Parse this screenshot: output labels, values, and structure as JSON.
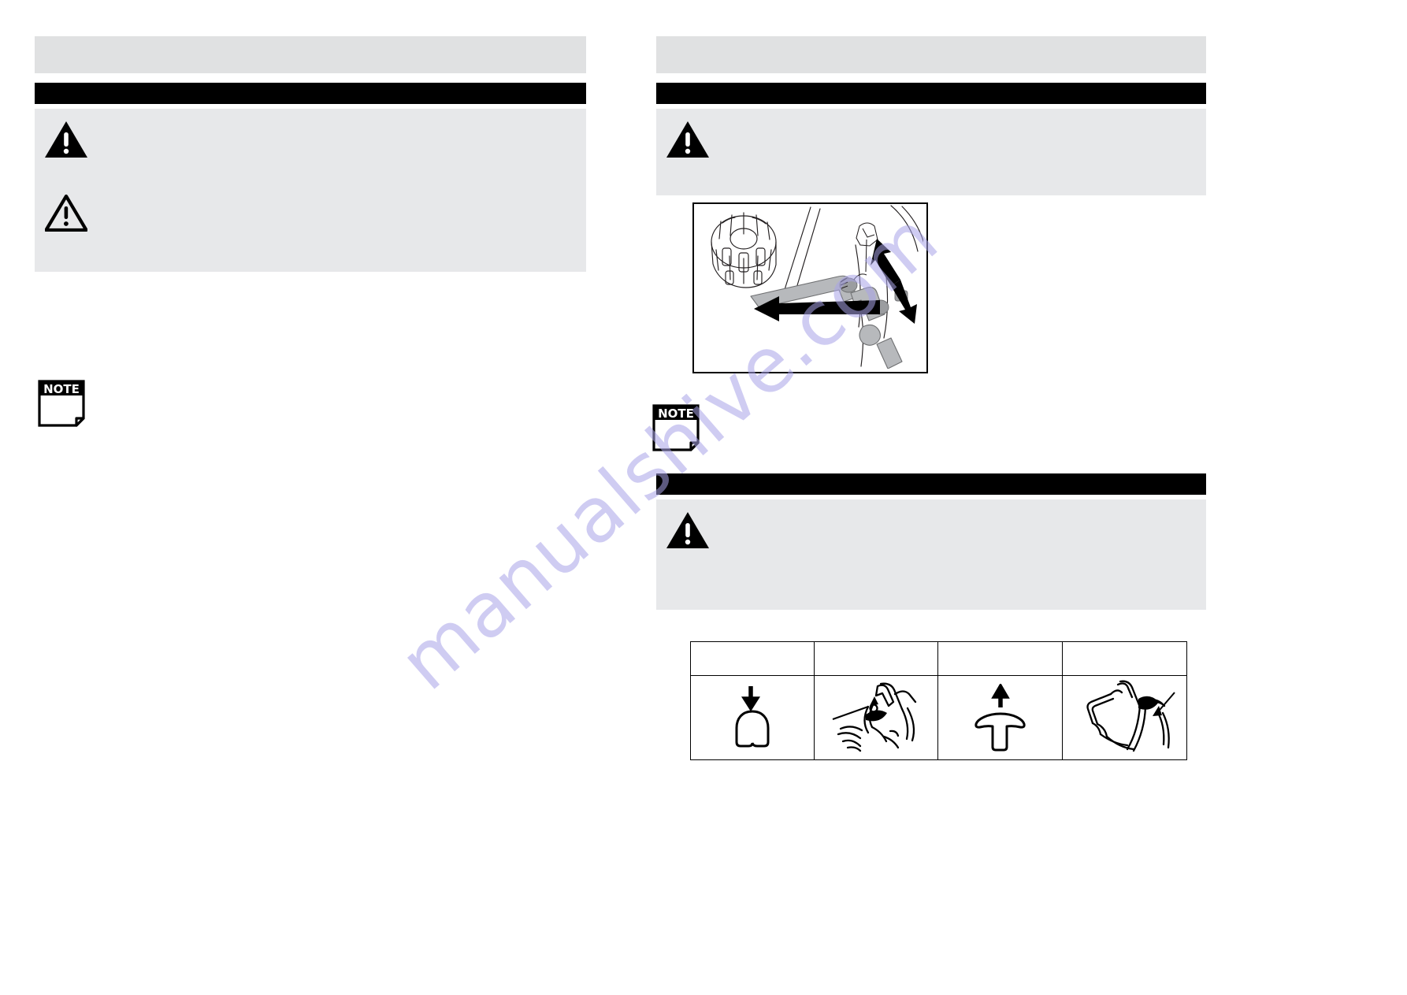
{
  "document": {
    "type": "scanned-manual-page",
    "watermark_text": "manualshive.com",
    "colors": {
      "gray_band": "#e0e1e2",
      "gray_box": "#e7e8ea",
      "black_bar": "#000000",
      "rule": "#000000",
      "watermark": "#a9a4e8"
    }
  },
  "left_column": {
    "heading_band": {
      "label": ""
    },
    "section_bar": {
      "label": ""
    },
    "warning_box": {
      "label": "",
      "icons": [
        {
          "name": "warning-triangle-solid",
          "glyph": "filled-triangle-exclamation"
        },
        {
          "name": "warning-triangle-outline",
          "glyph": "outline-triangle-exclamation"
        }
      ]
    },
    "note": {
      "icon_label": "NOTE",
      "text": ""
    }
  },
  "right_column": {
    "heading_band": {
      "label": ""
    },
    "section_bar_top": {
      "label": ""
    },
    "warning_box_top": {
      "label": "",
      "icons": [
        {
          "name": "warning-triangle-solid",
          "glyph": "filled-triangle-exclamation"
        }
      ]
    },
    "illustration": {
      "caption": "",
      "name": "knob-and-lever-adjustment-diagram",
      "parts": [
        "ribbed-knob",
        "bent-lever-arm",
        "bracket",
        "frame-tube"
      ],
      "arrows": [
        "double-headed-arrow-up-right",
        "left-pointing-arrow"
      ]
    },
    "note": {
      "icon_label": "NOTE",
      "text": ""
    },
    "section_bar_bottom": {
      "label": ""
    },
    "warning_box_bottom": {
      "label": "",
      "icons": [
        {
          "name": "warning-triangle-solid",
          "glyph": "filled-triangle-exclamation"
        }
      ]
    },
    "pictogram_table": {
      "headers": [
        "",
        "",
        "",
        ""
      ],
      "rows": [
        [
          {
            "name": "knob-press-down-pictogram",
            "caption": ""
          },
          {
            "name": "handle-lever-push-pictogram",
            "caption": ""
          },
          {
            "name": "knob-pull-up-pictogram",
            "caption": ""
          },
          {
            "name": "handle-lever-release-pictogram",
            "caption": ""
          }
        ]
      ]
    }
  }
}
